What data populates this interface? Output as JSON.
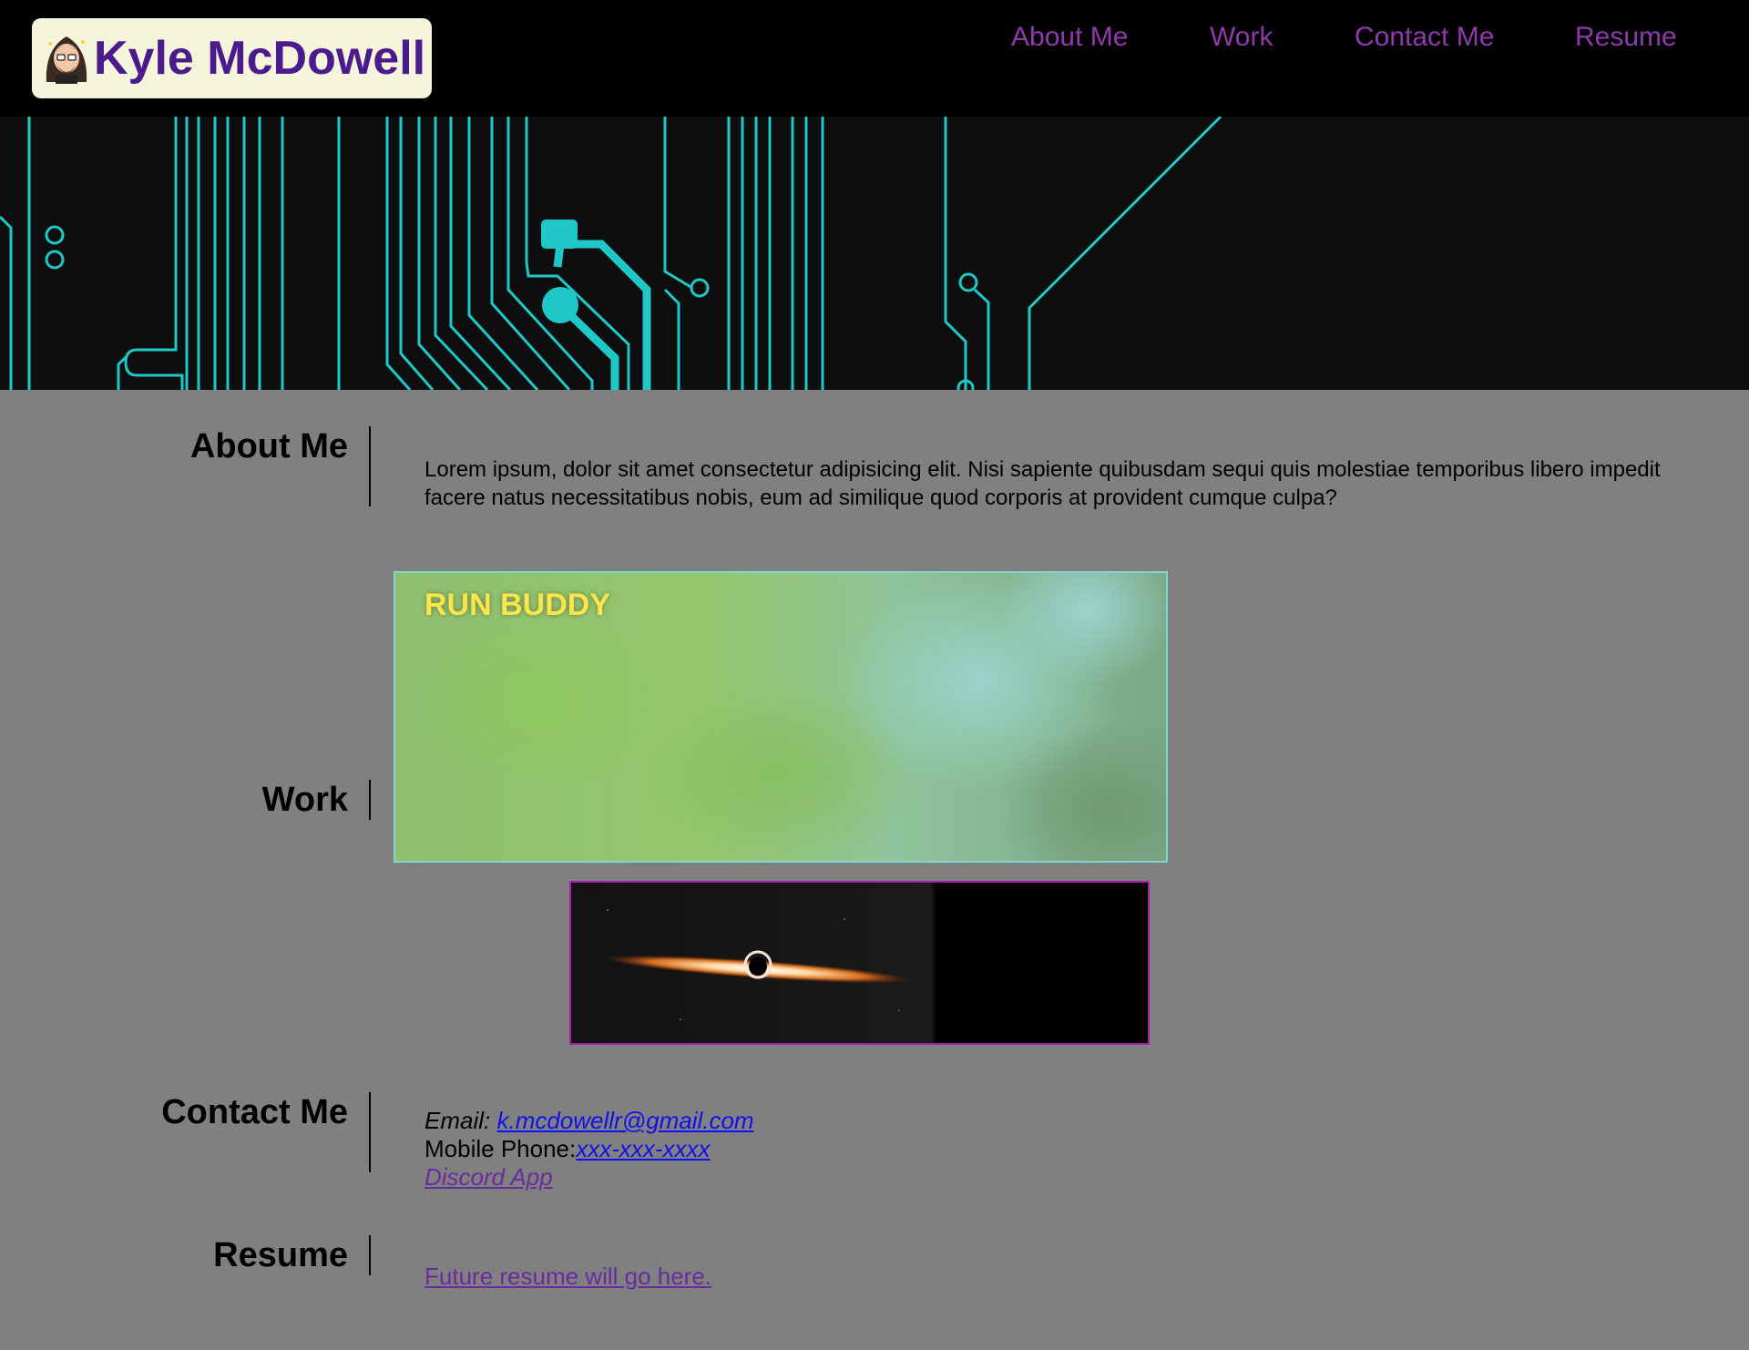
{
  "header": {
    "brand_name": "Kyle McDowell",
    "avatar_icon": "avatar-cartoon-icon",
    "nav": [
      "About Me",
      "Work",
      "Contact Me",
      "Resume"
    ]
  },
  "hero": {
    "decoration": "circuit-board-icon"
  },
  "sections": {
    "about": {
      "label": "About Me",
      "text": "Lorem ipsum, dolor sit amet consectetur adipisicing elit. Nisi sapiente quibusdam sequi quis molestiae temporibus libero impedit facere natus necessitatibus nobis, eum ad similique quod corporis at provident cumque culpa?"
    },
    "work": {
      "label": "Work",
      "projects": [
        {
          "title": "RUN BUDDY"
        },
        {
          "title": ""
        }
      ]
    },
    "contact": {
      "label": "Contact Me",
      "email_label": "Email: ",
      "email": "k.mcdowellr@gmail.com",
      "phone_label": "Mobile Phone:",
      "phone": "xxx-xxx-xxxx",
      "discord": "Discord App"
    },
    "resume": {
      "label": "Resume",
      "link": "Future resume will go here."
    }
  },
  "colors": {
    "accent_purple": "#8e3aab",
    "brand_purple": "#4b1a8c",
    "circuit_cyan": "#1ec8c8",
    "page_bg": "#808080"
  }
}
